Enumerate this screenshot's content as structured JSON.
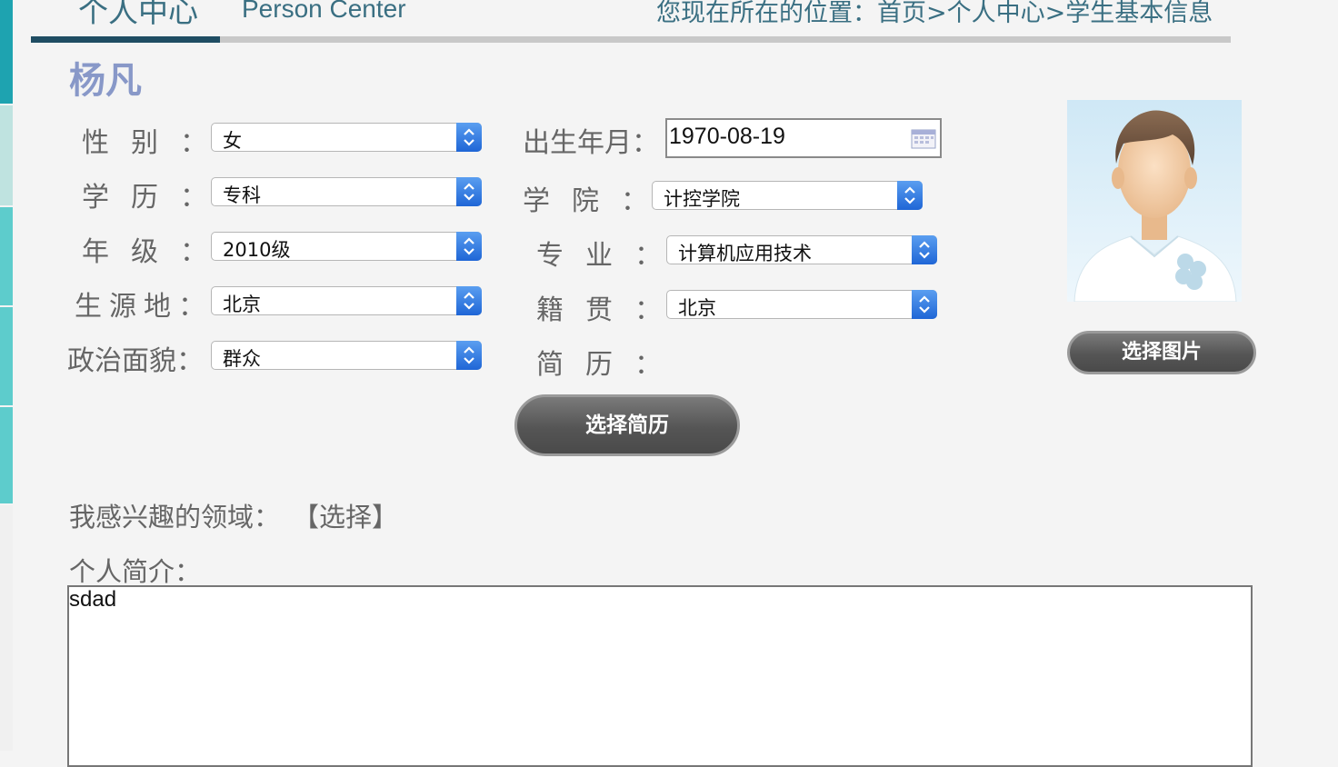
{
  "header": {
    "title": "个人中心",
    "title_en": "Person Center",
    "breadcrumb": "您现在所在的位置：首页>个人中心>学生基本信息"
  },
  "student": {
    "name": "杨凡"
  },
  "form": {
    "gender": {
      "label": "性  别：",
      "value": "女"
    },
    "birth": {
      "label": "出生年月：",
      "value": "1970-08-19"
    },
    "education": {
      "label": "学  历：",
      "value": "专科"
    },
    "college": {
      "label": "学  院：",
      "value": "计控学院"
    },
    "grade": {
      "label": "年  级：",
      "value": "2010级"
    },
    "major": {
      "label": "专  业：",
      "value": "计算机应用技术"
    },
    "origin": {
      "label": "生源地：",
      "value": "北京"
    },
    "native_place": {
      "label": "籍  贯：",
      "value": "北京"
    },
    "political": {
      "label": "政治面貌：",
      "value": "群众"
    },
    "resume": {
      "label": "简  历："
    }
  },
  "buttons": {
    "choose_picture": "选择图片",
    "choose_resume": "选择简历"
  },
  "interest": {
    "label": "我感兴趣的领域：",
    "select_label": "【选择】"
  },
  "intro": {
    "label": "个人简介：",
    "value": "sdad"
  },
  "colors": {
    "accent": "#1f4d63",
    "title": "#3a6f82",
    "name": "#8898c8",
    "sidebar": "#5dcccc"
  },
  "icons": {
    "select_arrow": "up-down-chevron-icon",
    "calendar": "calendar-icon",
    "avatar": "male-avatar-icon"
  }
}
